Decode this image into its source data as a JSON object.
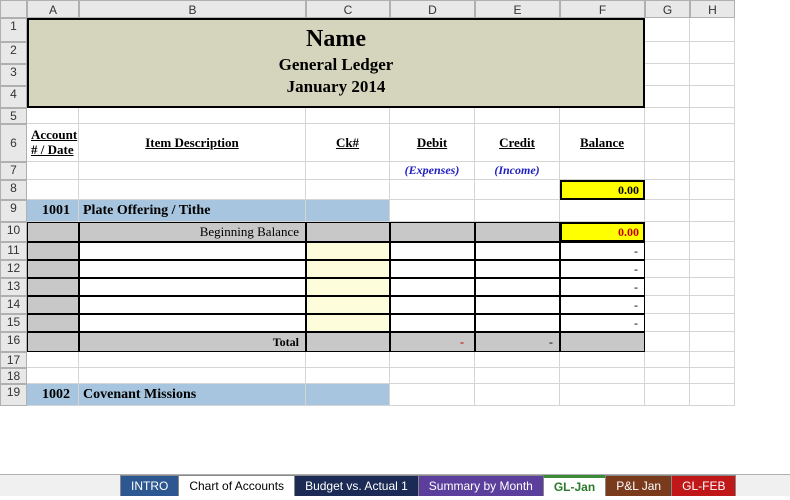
{
  "columns": [
    "A",
    "B",
    "C",
    "D",
    "E",
    "F",
    "G",
    "H"
  ],
  "rows": [
    "1",
    "2",
    "3",
    "4",
    "5",
    "6",
    "7",
    "8",
    "9",
    "10",
    "11",
    "12",
    "13",
    "14",
    "15",
    "16",
    "17",
    "18",
    "19"
  ],
  "banner": {
    "title": "Name",
    "subtitle": "General Ledger",
    "period": "January 2014"
  },
  "headers": {
    "account": "Account # / Date",
    "item": "Item Description",
    "ck": "Ck#",
    "debit": "Debit",
    "credit": "Credit",
    "balance": "Balance",
    "debit_sub": "(Expenses)",
    "credit_sub": "(Income)"
  },
  "top_balance": "0.00",
  "section1": {
    "acct": "1001",
    "name": "Plate Offering / Tithe",
    "begin_label": "Beginning Balance",
    "begin_value": "0.00",
    "blank_rows": [
      "-",
      "-",
      "-",
      "-",
      "-"
    ],
    "total_label": "Total",
    "total_debit": "-",
    "total_credit": "-"
  },
  "section2": {
    "acct": "1002",
    "name": "Covenant Missions"
  },
  "tabs": {
    "intro": "INTRO",
    "coa": "Chart of Accounts",
    "budget": "Budget vs. Actual 1",
    "summary": "Summary by Month",
    "gljan": "GL-Jan",
    "pljan": "P&L Jan",
    "glfeb": "GL-FEB"
  }
}
